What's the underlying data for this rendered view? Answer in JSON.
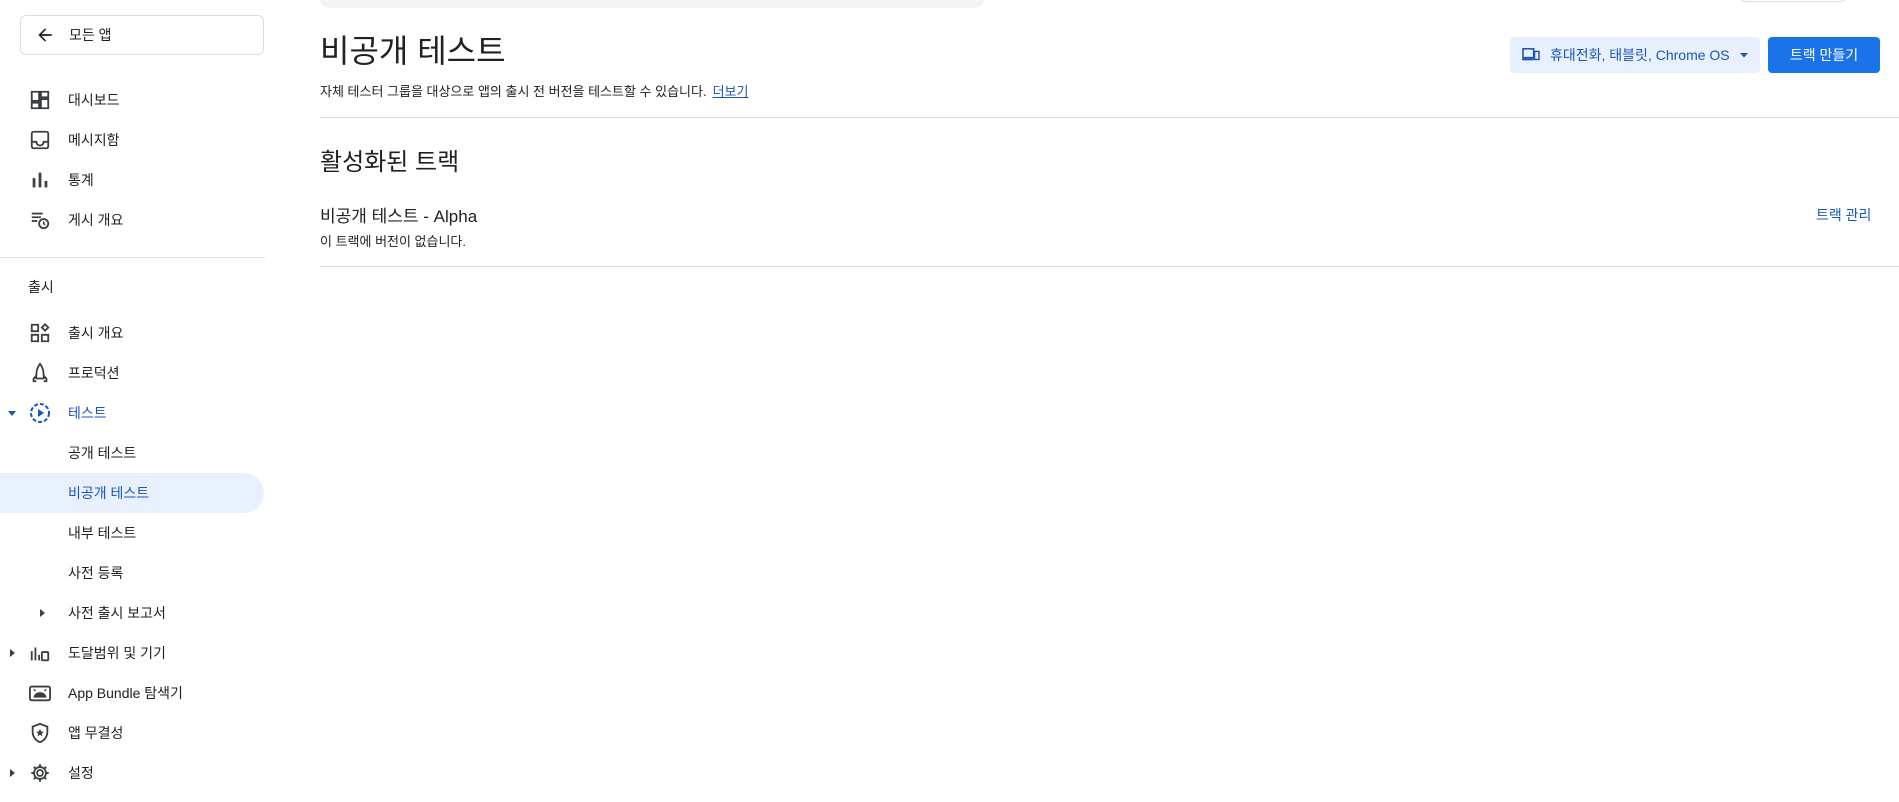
{
  "sidebar": {
    "back_label": "모든 앱",
    "top_items": [
      {
        "label": "대시보드",
        "icon": "dashboard-icon"
      },
      {
        "label": "메시지함",
        "icon": "inbox-icon"
      },
      {
        "label": "통계",
        "icon": "bar-chart-icon"
      },
      {
        "label": "게시 개요",
        "icon": "publishing-overview-icon"
      }
    ],
    "release_section_title": "출시",
    "release_items": [
      {
        "label": "출시 개요",
        "icon": "release-overview-icon"
      },
      {
        "label": "프로덕션",
        "icon": "production-icon"
      },
      {
        "label": "테스트",
        "icon": "testing-icon"
      },
      {
        "label": "공개 테스트"
      },
      {
        "label": "비공개 테스트"
      },
      {
        "label": "내부 테스트"
      },
      {
        "label": "사전 등록"
      },
      {
        "label": "사전 출시 보고서"
      },
      {
        "label": "도달범위 및 기기",
        "icon": "reach-devices-icon"
      },
      {
        "label": "App Bundle 탐색기",
        "icon": "android-icon"
      },
      {
        "label": "앱 무결성",
        "icon": "shield-icon"
      },
      {
        "label": "설정",
        "icon": "gear-icon"
      }
    ]
  },
  "header": {
    "title": "비공개 테스트",
    "description": "자체 테스터 그룹을 대상으로 앱의 출시 전 버전을 테스트할 수 있습니다.",
    "learn_more": "더보기",
    "device_filter": "휴대전화, 태블릿, Chrome OS",
    "create_track": "트랙 만들기"
  },
  "active_tracks": {
    "heading": "활성화된 트랙",
    "tracks": [
      {
        "name": "비공개 테스트 - Alpha",
        "status": "이 트랙에 버전이 없습니다.",
        "manage": "트랙 관리"
      }
    ]
  },
  "colors": {
    "accent": "#1a73e8",
    "active_bg": "#e8f0fe",
    "link": "#1a56b8"
  }
}
